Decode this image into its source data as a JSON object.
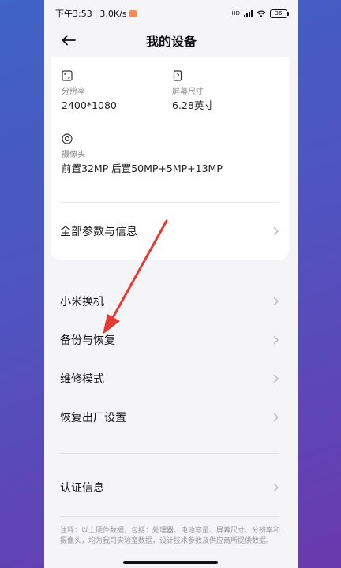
{
  "status_bar": {
    "time": "下午3:53",
    "speed": "3.0K/s",
    "signal": "HD",
    "battery": "36"
  },
  "header": {
    "title": "我的设备"
  },
  "specs": [
    {
      "label": "分辨率",
      "value": "2400*1080",
      "icon": "screen-resolution-icon"
    },
    {
      "label": "屏幕尺寸",
      "value": "6.28英寸",
      "icon": "screen-size-icon"
    },
    {
      "label": "摄像头",
      "value": "前置32MP 后置50MP+5MP+13MP",
      "icon": "camera-icon"
    }
  ],
  "card_row": {
    "label": "全部参数与信息"
  },
  "menu": [
    {
      "label": "小米换机"
    },
    {
      "label": "备份与恢复"
    },
    {
      "label": "维修模式"
    },
    {
      "label": "恢复出厂设置"
    }
  ],
  "cert": {
    "label": "认证信息"
  },
  "footnote": "注释：以上硬件数据，包括：处理器、电池容量、屏幕尺寸、分辨率和摄像头，均为我司实验室数据，设计技术参数及供应商所提供数据。",
  "colors": {
    "annotation_arrow": "#e53935",
    "background_top": "#3f63c6",
    "background_bottom": "#6a3aae"
  }
}
